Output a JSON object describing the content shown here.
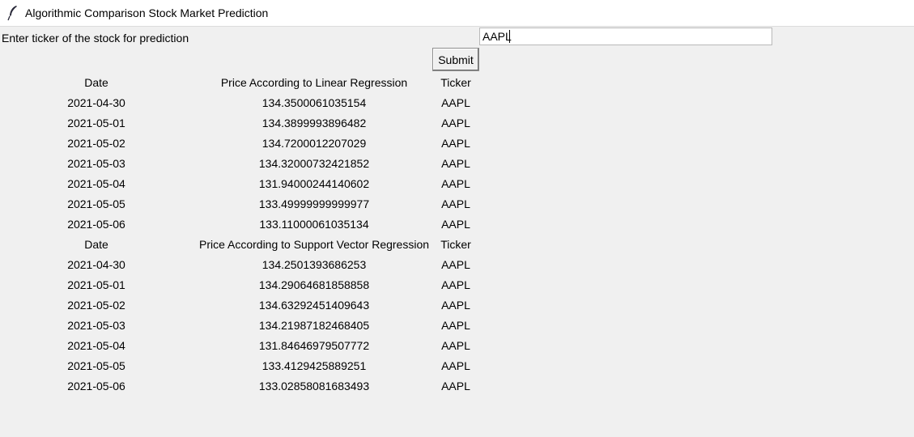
{
  "window": {
    "title": "Algorithmic Comparison Stock Market Prediction",
    "icon": "feather-icon"
  },
  "form": {
    "label": "Enter ticker of the stock for prediction",
    "ticker_value": "AAPL",
    "submit_label": "Submit"
  },
  "tables": [
    {
      "headers": [
        "Date",
        "Price According to Linear Regression",
        "Ticker"
      ],
      "rows": [
        [
          "2021-04-30",
          "134.3500061035154",
          "AAPL"
        ],
        [
          "2021-05-01",
          "134.3899993896482",
          "AAPL"
        ],
        [
          "2021-05-02",
          "134.7200012207029",
          "AAPL"
        ],
        [
          "2021-05-03",
          "134.32000732421852",
          "AAPL"
        ],
        [
          "2021-05-04",
          "131.94000244140602",
          "AAPL"
        ],
        [
          "2021-05-05",
          "133.49999999999977",
          "AAPL"
        ],
        [
          "2021-05-06",
          "133.11000061035134",
          "AAPL"
        ]
      ]
    },
    {
      "headers": [
        "Date",
        "Price According to Support Vector Regression",
        "Ticker"
      ],
      "rows": [
        [
          "2021-04-30",
          "134.2501393686253",
          "AAPL"
        ],
        [
          "2021-05-01",
          "134.29064681858858",
          "AAPL"
        ],
        [
          "2021-05-02",
          "134.63292451409643",
          "AAPL"
        ],
        [
          "2021-05-03",
          "134.21987182468405",
          "AAPL"
        ],
        [
          "2021-05-04",
          "131.84646979507772",
          "AAPL"
        ],
        [
          "2021-05-05",
          "133.4129425889251",
          "AAPL"
        ],
        [
          "2021-05-06",
          "133.02858081683493",
          "AAPL"
        ]
      ]
    }
  ]
}
